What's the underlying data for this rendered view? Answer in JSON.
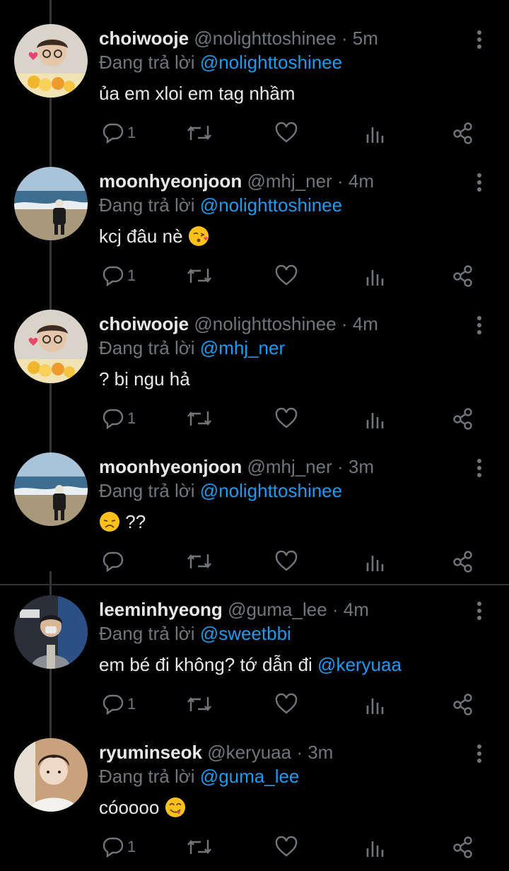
{
  "reply_prefix": "Đang trả lời",
  "tweets": [
    {
      "name": "choiwooje",
      "handle": "@nolighttoshinee",
      "time": "· 5m",
      "reply_to": "@nolighttoshinee",
      "text": "ủa em xloi em tag nhầm",
      "text_mention": "",
      "emoji": "",
      "text_after": "",
      "replies": "1",
      "avatar": "choi"
    },
    {
      "name": "moonhyeonjoon",
      "handle": "@mhj_ner",
      "time": "· 4m",
      "reply_to": "@nolighttoshinee",
      "text": "kcj đâu nè",
      "text_mention": "",
      "emoji": "kiss",
      "text_after": "",
      "replies": "1",
      "avatar": "moon"
    },
    {
      "name": "choiwooje",
      "handle": "@nolighttoshinee",
      "time": "· 4m",
      "reply_to": "@mhj_ner",
      "text": "? bị ngu hả",
      "text_mention": "",
      "emoji": "",
      "text_after": "",
      "replies": "1",
      "avatar": "choi"
    },
    {
      "name": "moonhyeonjoon",
      "handle": "@mhj_ner",
      "time": "· 3m",
      "reply_to": "@nolighttoshinee",
      "text": "",
      "text_mention": "",
      "emoji": "disappointed",
      "text_after": "??",
      "replies": "",
      "avatar": "moon"
    },
    {
      "name": "leeminhyeong",
      "handle": "@guma_lee",
      "time": "· 4m",
      "reply_to": "@sweetbbi",
      "text": "em bé đi không? tớ dẫn đi",
      "text_mention": "@keryuaa",
      "emoji": "",
      "text_after": "",
      "replies": "1",
      "avatar": "lee"
    },
    {
      "name": "ryuminseok",
      "handle": "@keryuaa",
      "time": "· 3m",
      "reply_to": "@guma_lee",
      "text": "cóoooo",
      "text_mention": "",
      "emoji": "yum",
      "text_after": "",
      "replies": "1",
      "avatar": "ryu"
    }
  ],
  "icons": {
    "reply": "reply-icon",
    "retweet": "retweet-icon",
    "like": "heart-icon",
    "views": "analytics-icon",
    "share": "share-icon",
    "more": "more-vertical-icon"
  },
  "colors": {
    "background": "#000000",
    "mention": "#1d9bf0",
    "muted": "#71767b",
    "text": "#e7e9ea"
  }
}
